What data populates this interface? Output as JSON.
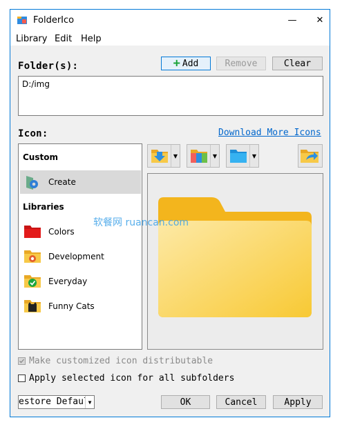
{
  "window": {
    "title": "FolderIco",
    "minimize": "—",
    "close": "✕"
  },
  "menu": [
    "Library",
    "Edit",
    "Help"
  ],
  "folders": {
    "label": "Folder(s):",
    "add_label": "Add",
    "remove_label": "Remove",
    "clear_label": "Clear",
    "value": "D:/img"
  },
  "icon_section": {
    "label": "Icon:",
    "download_link": "Download More Icons"
  },
  "library": {
    "custom_title": "Custom",
    "custom_items": [
      {
        "label": "Create",
        "icon": "gear-folder-icon"
      }
    ],
    "libraries_title": "Libraries",
    "library_items": [
      {
        "label": "Colors",
        "icon": "red-folder-icon"
      },
      {
        "label": "Development",
        "icon": "development-folder-icon"
      },
      {
        "label": "Everyday",
        "icon": "checkmark-folder-icon"
      },
      {
        "label": "Funny Cats",
        "icon": "cat-folder-icon"
      }
    ]
  },
  "watermark": "软餐网 ruancan.com",
  "options": {
    "distributable": "Make customized icon distributable",
    "subfolders": "Apply selected icon for all subfolders"
  },
  "footer": {
    "restore_value": "estore Defaul",
    "ok_label": "OK",
    "cancel_label": "Cancel",
    "apply_label": "Apply"
  },
  "colors": {
    "accent": "#0078d7",
    "folder": "#f7c948",
    "link": "#0066cc"
  }
}
